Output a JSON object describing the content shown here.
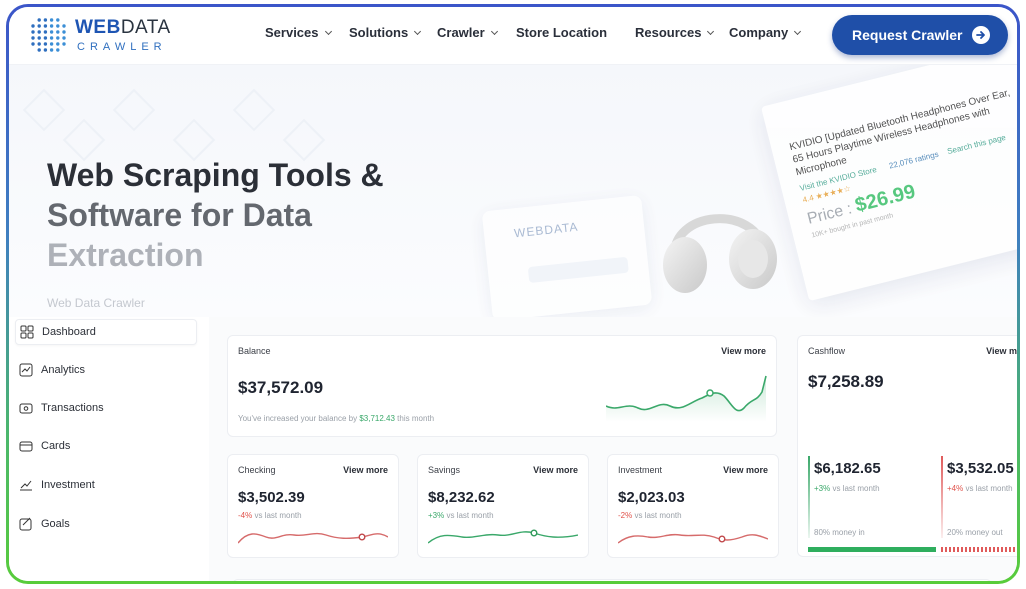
{
  "brand": {
    "name_bold": "WEB",
    "name_rest": "DATA",
    "sub": "CRAWLER"
  },
  "nav": [
    {
      "label": "Services",
      "has_dropdown": true
    },
    {
      "label": "Solutions",
      "has_dropdown": true
    },
    {
      "label": "Crawler",
      "has_dropdown": true
    },
    {
      "label": "Store Location",
      "has_dropdown": false
    },
    {
      "label": "Resources",
      "has_dropdown": true
    },
    {
      "label": "Company",
      "has_dropdown": true
    }
  ],
  "cta": {
    "label": "Request Crawler",
    "icon": "arrow-right-icon"
  },
  "hero": {
    "title_line1": "Web Scraping Tools &",
    "title_line2": "Software for Data",
    "title_line3": "Extraction",
    "subtitle": "Web Data Crawler"
  },
  "product": {
    "title": "KVIDIO [Updated Bluetooth Headphones Over Ear, 65 Hours Playtime Wireless Headphones with Microphone",
    "store": "Visit the KVIDIO Store",
    "ratings": "22,076 ratings",
    "search": "Search this page",
    "stars": "4.4 ★★★★☆",
    "price_label": "Price :",
    "price": "$26.99",
    "bought": "10K+ bought in past month"
  },
  "mock_browser": {
    "logo": "WEBDATA"
  },
  "sidebar": {
    "items": [
      {
        "label": "Dashboard",
        "icon": "grid-icon",
        "active": true
      },
      {
        "label": "Analytics",
        "icon": "chart-line-icon",
        "active": false
      },
      {
        "label": "Transactions",
        "icon": "wallet-icon",
        "active": false
      },
      {
        "label": "Cards",
        "icon": "credit-card-icon",
        "active": false
      },
      {
        "label": "Investment",
        "icon": "trending-icon",
        "active": false
      },
      {
        "label": "Goals",
        "icon": "goal-icon",
        "active": false
      }
    ]
  },
  "balance": {
    "label": "Balance",
    "view_more": "View more",
    "amount": "$37,572.09",
    "note_prefix": "You've increased your balance by",
    "note_value": "$3,712.43",
    "note_suffix": "this month"
  },
  "cashflow": {
    "label": "Cashflow",
    "view_more": "View more",
    "amount": "$7,258.89",
    "money_in": {
      "amount": "$6,182.65",
      "change": "+3%",
      "change_suffix": "vs last month",
      "caption": "80% money in"
    },
    "money_out": {
      "amount": "$3,532.05",
      "change": "+4%",
      "change_suffix": "vs last month",
      "caption": "20% money out"
    },
    "accent_in": "#2fae5e",
    "accent_out": "#e05a5a"
  },
  "accounts": [
    {
      "label": "Checking",
      "view_more": "View more",
      "amount": "$3,502.39",
      "change": "-4%",
      "change_suffix": "vs last month",
      "trend": "neg"
    },
    {
      "label": "Savings",
      "view_more": "View more",
      "amount": "$8,232.62",
      "change": "+3%",
      "change_suffix": "vs last month",
      "trend": "pos"
    },
    {
      "label": "Investment",
      "view_more": "View more",
      "amount": "$2,023.03",
      "change": "-2%",
      "change_suffix": "vs last month",
      "trend": "neg"
    }
  ],
  "colors": {
    "brand": "#1f4fa8",
    "positive": "#3aa86a",
    "negative": "#e0514a"
  }
}
